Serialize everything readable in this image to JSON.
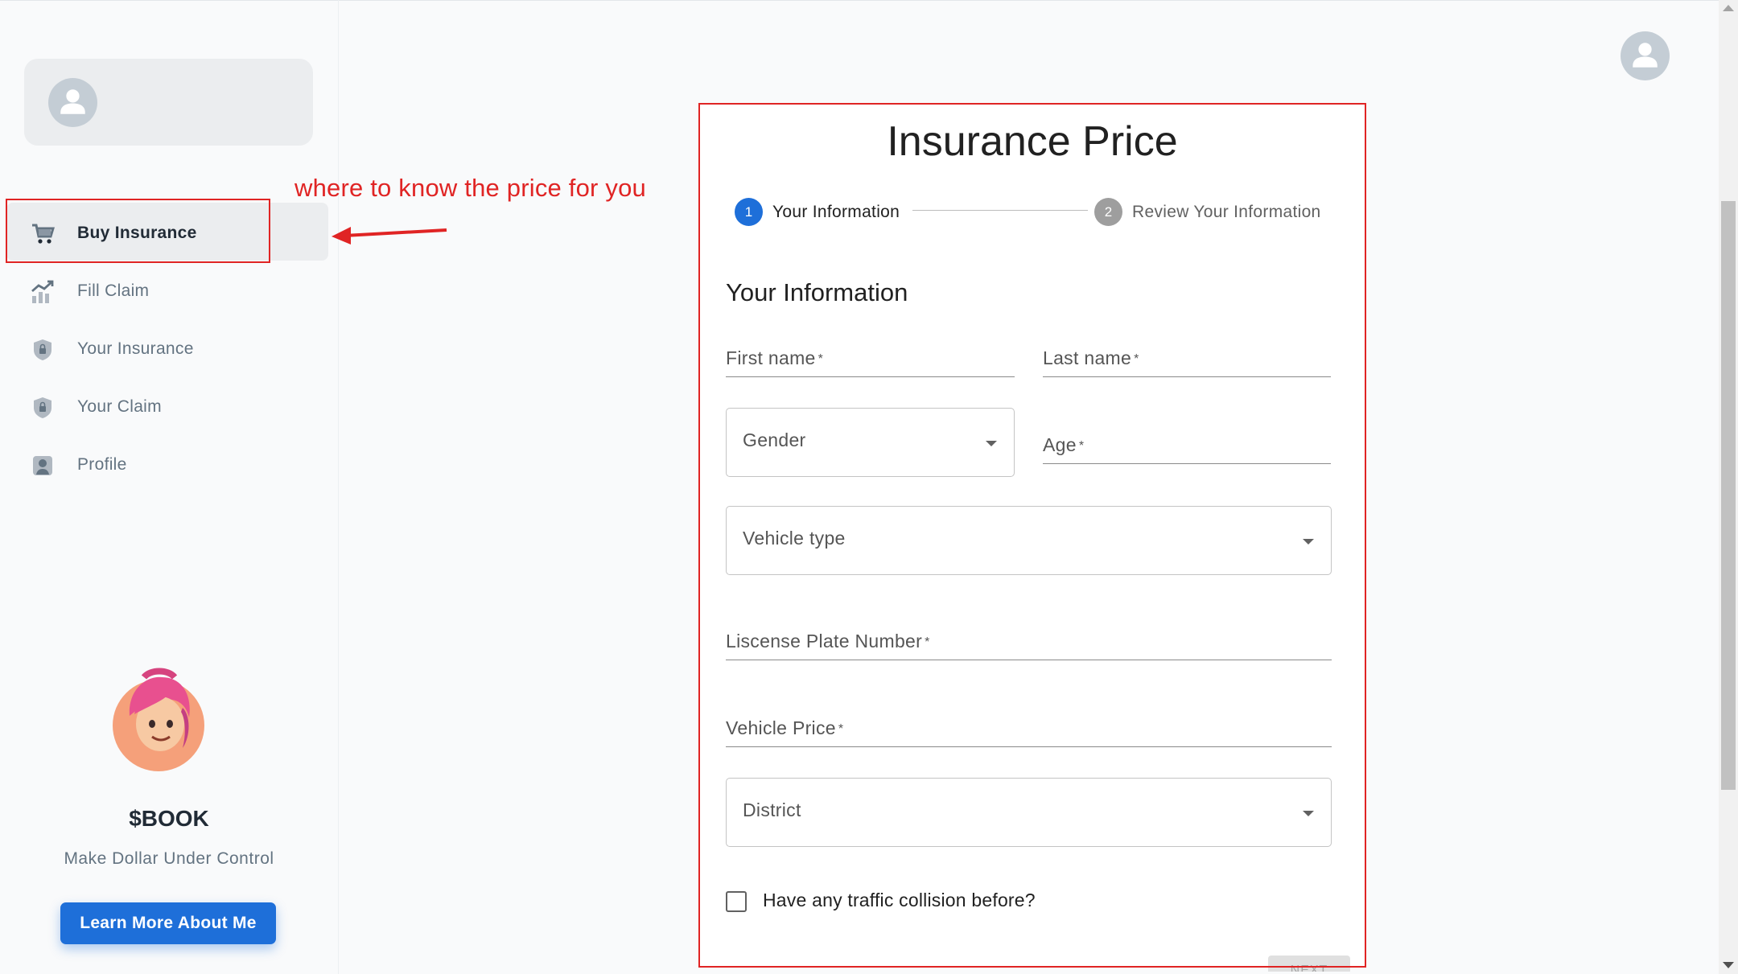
{
  "sidebar": {
    "nav": [
      {
        "label": "Buy Insurance",
        "icon": "cart-icon"
      },
      {
        "label": "Fill Claim",
        "icon": "chart-icon"
      },
      {
        "label": "Your Insurance",
        "icon": "shield-lock-icon"
      },
      {
        "label": "Your Claim",
        "icon": "shield-lock-icon"
      },
      {
        "label": "Profile",
        "icon": "profile-icon"
      }
    ],
    "promo": {
      "title": "$BOOK",
      "subtitle": "Make Dollar Under Control",
      "button": "Learn More About Me"
    }
  },
  "annotation": {
    "text": "where to know the price for you",
    "color": "#e02424"
  },
  "form": {
    "title": "Insurance Price",
    "steps": [
      {
        "number": "1",
        "label": "Your Information",
        "active": true
      },
      {
        "number": "2",
        "label": "Review Your Information",
        "active": false
      }
    ],
    "section_title": "Your Information",
    "fields": {
      "first_name": "First name",
      "last_name": "Last name",
      "gender": "Gender",
      "age": "Age",
      "vehicle_type": "Vehicle type",
      "plate": "Liscense Plate Number",
      "vehicle_price": "Vehicle Price",
      "district": "District"
    },
    "required_mark": "*",
    "checkbox_label": "Have any traffic collision before?",
    "next_label": "NEXT"
  },
  "colors": {
    "primary": "#1e6fd9",
    "step_inactive": "#9e9e9e",
    "sidebar_active_bg": "#ebedef"
  }
}
